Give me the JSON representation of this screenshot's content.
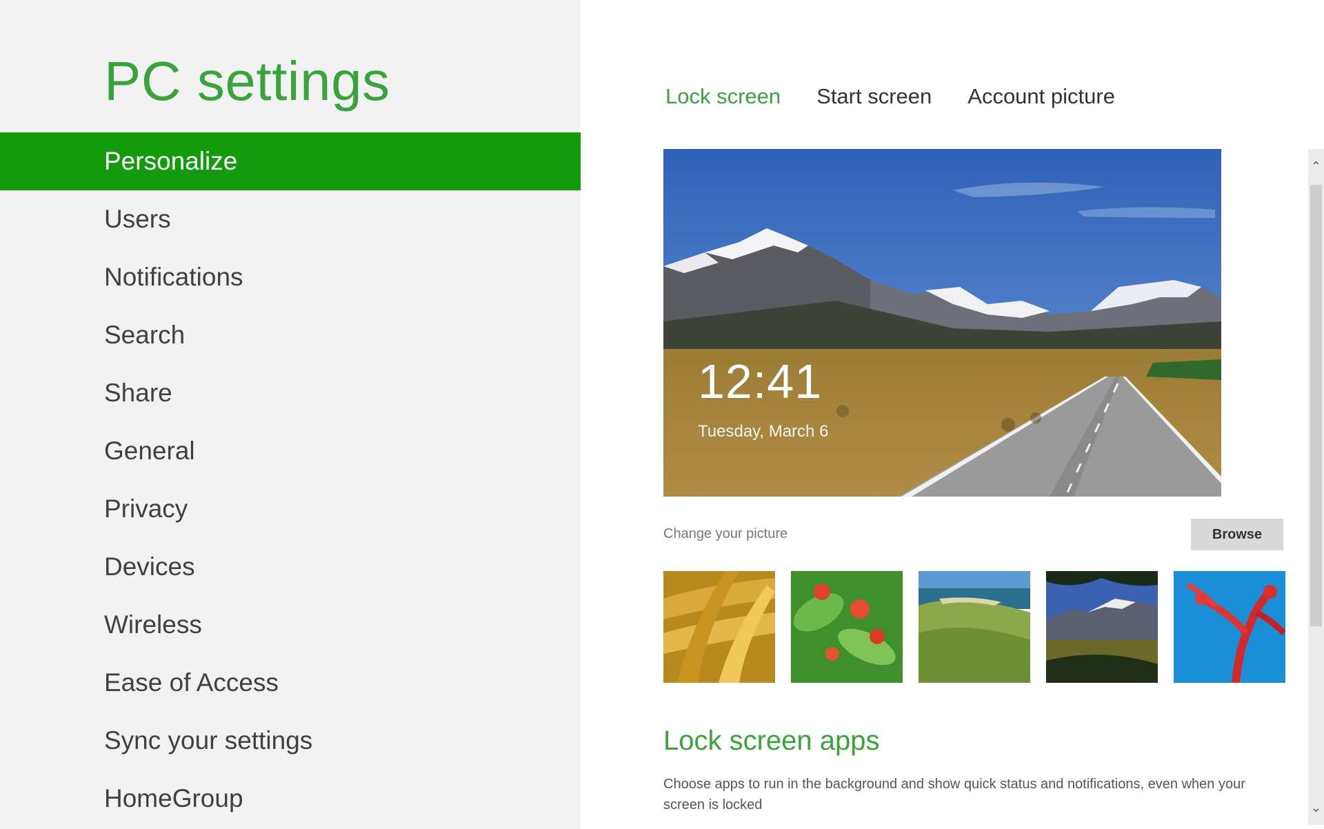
{
  "sidebar": {
    "title": "PC settings",
    "items": [
      {
        "label": "Personalize",
        "selected": true
      },
      {
        "label": "Users"
      },
      {
        "label": "Notifications"
      },
      {
        "label": "Search"
      },
      {
        "label": "Share"
      },
      {
        "label": "General"
      },
      {
        "label": "Privacy"
      },
      {
        "label": "Devices"
      },
      {
        "label": "Wireless"
      },
      {
        "label": "Ease of Access"
      },
      {
        "label": "Sync your settings"
      },
      {
        "label": "HomeGroup"
      }
    ]
  },
  "tabs": [
    {
      "label": "Lock screen",
      "active": true
    },
    {
      "label": "Start screen"
    },
    {
      "label": "Account picture"
    }
  ],
  "lock_preview": {
    "time": "12:41",
    "date": "Tuesday, March 6"
  },
  "change_picture": {
    "label": "Change your picture",
    "browse_label": "Browse"
  },
  "thumbnails": [
    "wheat-grass",
    "red-flowers",
    "green-hills-coast",
    "mountain-valley",
    "red-coral"
  ],
  "lock_screen_apps": {
    "title": "Lock screen apps",
    "description": "Choose apps to run in the background and show quick status and notifications, even when your screen is locked"
  },
  "colors": {
    "accent": "#3aa33c",
    "selected_bg": "#139a0d",
    "sidebar_bg": "#f2f2f2"
  },
  "scrollbar": {
    "up_icon": "chevron-up-icon",
    "down_icon": "chevron-down-icon"
  }
}
